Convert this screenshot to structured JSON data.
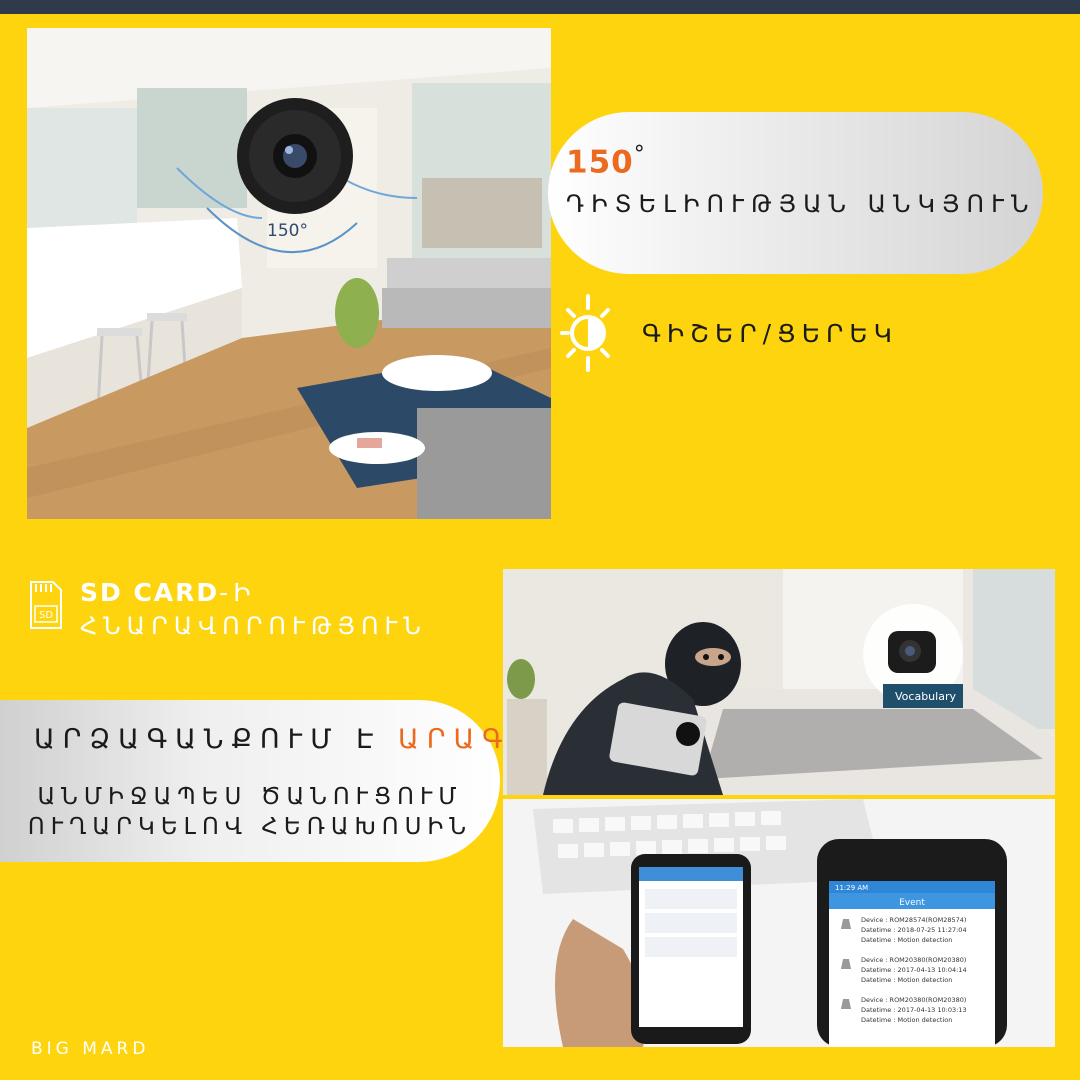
{
  "angle_block": {
    "value": "150",
    "degree": "°",
    "label": "ԴԻՏԵԼԻՈՒԹՅԱՆ ԱՆԿՅՈՒՆ"
  },
  "room_photo": {
    "angle_label": "150°"
  },
  "daynight": {
    "label": "ԳԻՇԵՐ/ՑԵՐԵԿ"
  },
  "sd_card": {
    "title": "SD CARD",
    "title_suffix": "-Ի",
    "subtitle": "ՀՆԱՐԱՎՈՐՈՒԹՅՈՒՆ",
    "icon_text": "SD"
  },
  "record_block": {
    "head_prefix": "ԱՐՁԱԳԱՆՔՈՒՄ Է ",
    "head_accent": "ԱՐԱԳ՝",
    "line1": "ԱՆՄԻՋԱՊԵՍ ԾԱՆՈՒՑՈՒՄ",
    "line2": "ՈՒՂԱՐԿԵԼՈՎ ՀԵՌԱԽՈՍԻՆ"
  },
  "thief_photo": {
    "book_text": "Vocabulary"
  },
  "phones_photo": {
    "screen_title": "Event",
    "status_time": "11:29 AM",
    "events": [
      {
        "device": "Device : ROM28574(ROM28574)",
        "datetime": "Datetime : 2018-07-25 11:27:04",
        "motion": "Datetime : Motion detection"
      },
      {
        "device": "Device : ROM20380(ROM20380)",
        "datetime": "Datetime : 2017-04-13 10:04:14",
        "motion": "Datetime : Motion detection"
      },
      {
        "device": "Device : ROM20380(ROM20380)",
        "datetime": "Datetime : 2017-04-13 10:03:13",
        "motion": "Datetime : Motion detection"
      }
    ]
  },
  "brand": "BIG MARD",
  "colors": {
    "background": "#fdd40e",
    "accent": "#ec6a1f",
    "border": "#2f3a4a"
  }
}
